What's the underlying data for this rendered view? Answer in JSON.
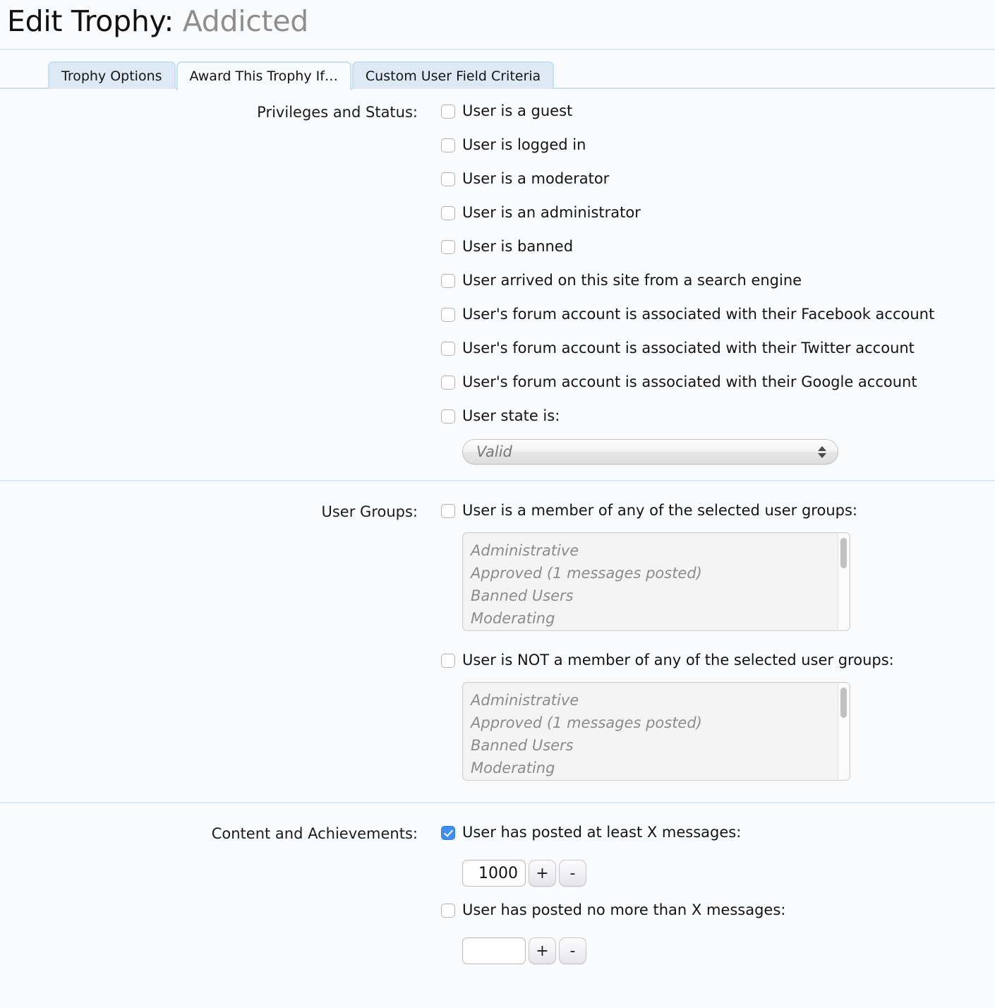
{
  "header": {
    "title_prefix": "Edit Trophy:",
    "title_name": "Addicted"
  },
  "tabs": [
    {
      "label": "Trophy Options",
      "active": false
    },
    {
      "label": "Award This Trophy If…",
      "active": true
    },
    {
      "label": "Custom User Field Criteria",
      "active": false
    }
  ],
  "sections": {
    "privileges": {
      "label": "Privileges and Status:",
      "checkboxes": [
        {
          "label": "User is a guest",
          "checked": false
        },
        {
          "label": "User is logged in",
          "checked": false
        },
        {
          "label": "User is a moderator",
          "checked": false
        },
        {
          "label": "User is an administrator",
          "checked": false
        },
        {
          "label": "User is banned",
          "checked": false
        },
        {
          "label": "User arrived on this site from a search engine",
          "checked": false
        },
        {
          "label": "User's forum account is associated with their Facebook account",
          "checked": false
        },
        {
          "label": "User's forum account is associated with their Twitter account",
          "checked": false
        },
        {
          "label": "User's forum account is associated with their Google account",
          "checked": false
        },
        {
          "label": "User state is:",
          "checked": false
        }
      ],
      "state_select": {
        "selected": "Valid"
      }
    },
    "user_groups": {
      "label": "User Groups:",
      "member_checkbox": "User is a member of any of the selected user groups:",
      "member_checked": false,
      "not_member_checkbox": "User is NOT a member of any of the selected user groups:",
      "not_member_checked": false,
      "group_options": [
        "Administrative",
        "Approved (1 messages posted)",
        "Banned Users",
        "Moderating"
      ]
    },
    "content": {
      "label": "Content and Achievements:",
      "at_least_label": "User has posted at least X messages:",
      "at_least_checked": true,
      "at_least_value": "1000",
      "no_more_than_label": "User has posted no more than X messages:",
      "no_more_than_checked": false,
      "no_more_than_value": "",
      "plus_label": "+",
      "minus_label": "-"
    }
  },
  "colors": {
    "accent_checked": "#3d8ff2",
    "rule": "#dceaf6",
    "tab_inactive_bg": "#ddeaf6",
    "page_bg": "#fafbfd"
  }
}
